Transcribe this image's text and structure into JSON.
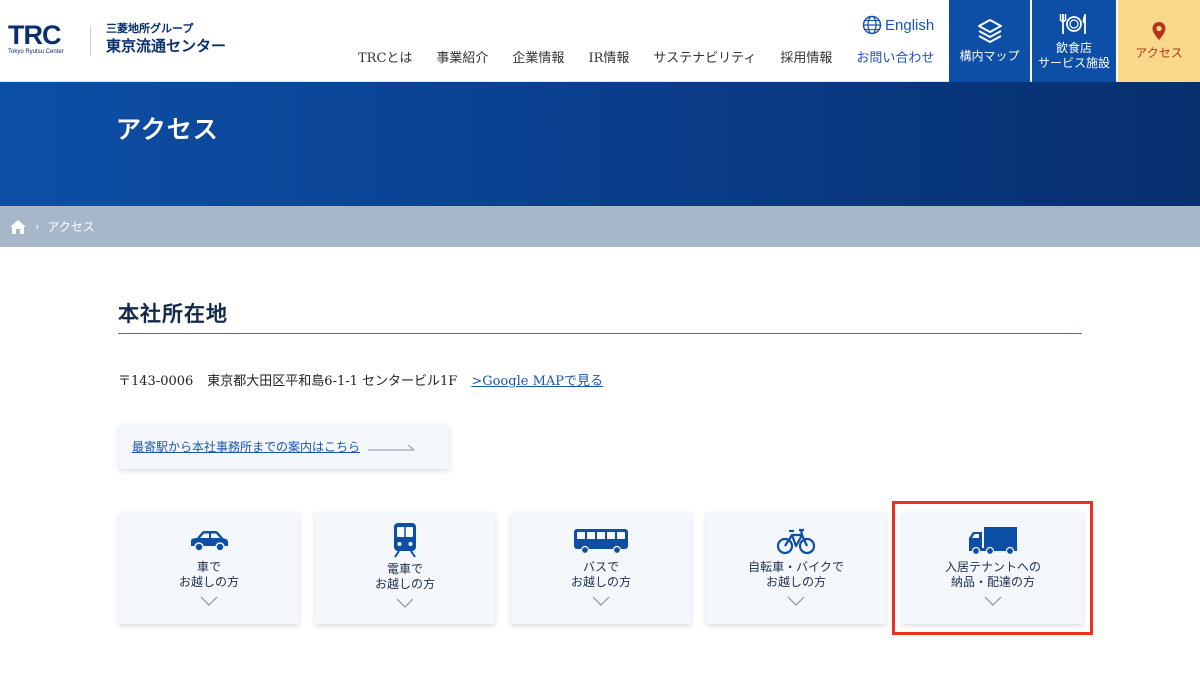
{
  "header": {
    "logo_text": "TRC",
    "logo_subtext": "Tokyo Ryutsu Center",
    "brand_group": "三菱地所グループ",
    "brand_name": "東京流通センター",
    "english_label": "English",
    "nav": [
      {
        "label": "TRCとは"
      },
      {
        "label": "事業紹介"
      },
      {
        "label": "企業情報"
      },
      {
        "label": "IR情報"
      },
      {
        "label": "サステナビリティ"
      },
      {
        "label": "採用情報"
      },
      {
        "label": "お問い合わせ"
      }
    ],
    "buttons": {
      "map": "構内マップ",
      "food": "飲食店\nサービス施設",
      "access": "アクセス"
    }
  },
  "hero": {
    "title": "アクセス"
  },
  "breadcrumb": {
    "current": "アクセス"
  },
  "section": {
    "title": "本社所在地",
    "postal": "〒143-0006",
    "address": "東京都大田区平和島6-1-1 センタービル1F",
    "map_link": ">Google MAPで見る"
  },
  "guide_link": "最寄駅から本社事務所までの案内はこちら",
  "cards": [
    {
      "label": "車で\nお越しの方",
      "icon": "car-icon"
    },
    {
      "label": "電車で\nお越しの方",
      "icon": "train-icon"
    },
    {
      "label": "バスで\nお越しの方",
      "icon": "bus-icon"
    },
    {
      "label": "自転車・バイクで\nお越しの方",
      "icon": "bicycle-icon"
    },
    {
      "label": "入居テナントへの\n納品・配達の方",
      "icon": "truck-icon"
    }
  ],
  "colors": {
    "brand_blue": "#0d4ea6",
    "navy": "#0a2f70",
    "access_bg": "#fad98a",
    "access_text": "#b5341e",
    "breadcrumb_bg": "#a7b7ca",
    "highlight": "#e8321e"
  }
}
